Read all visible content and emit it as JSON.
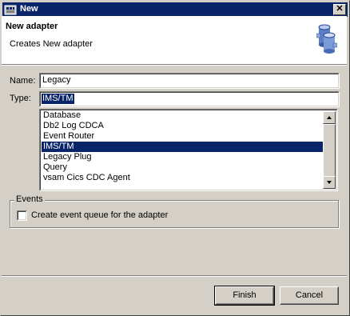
{
  "window": {
    "title": "New",
    "close_glyph": "✕"
  },
  "header": {
    "title": "New adapter",
    "description": "Creates New adapter",
    "icon": "database-adapter-icon"
  },
  "form": {
    "name_label": "Name:",
    "name_value": "Legacy",
    "type_label": "Type:",
    "type_value": "IMS/TM"
  },
  "type_list": {
    "items": [
      "Database",
      "Db2 Log CDCA",
      "Event Router",
      "IMS/TM",
      "Legacy Plug",
      "Query",
      "vsam Cics CDC Agent"
    ],
    "selected": "IMS/TM"
  },
  "events": {
    "group_title": "Events",
    "checkbox_label": "Create event queue for the adapter",
    "checked": false
  },
  "buttons": {
    "finish": "Finish",
    "cancel": "Cancel"
  }
}
